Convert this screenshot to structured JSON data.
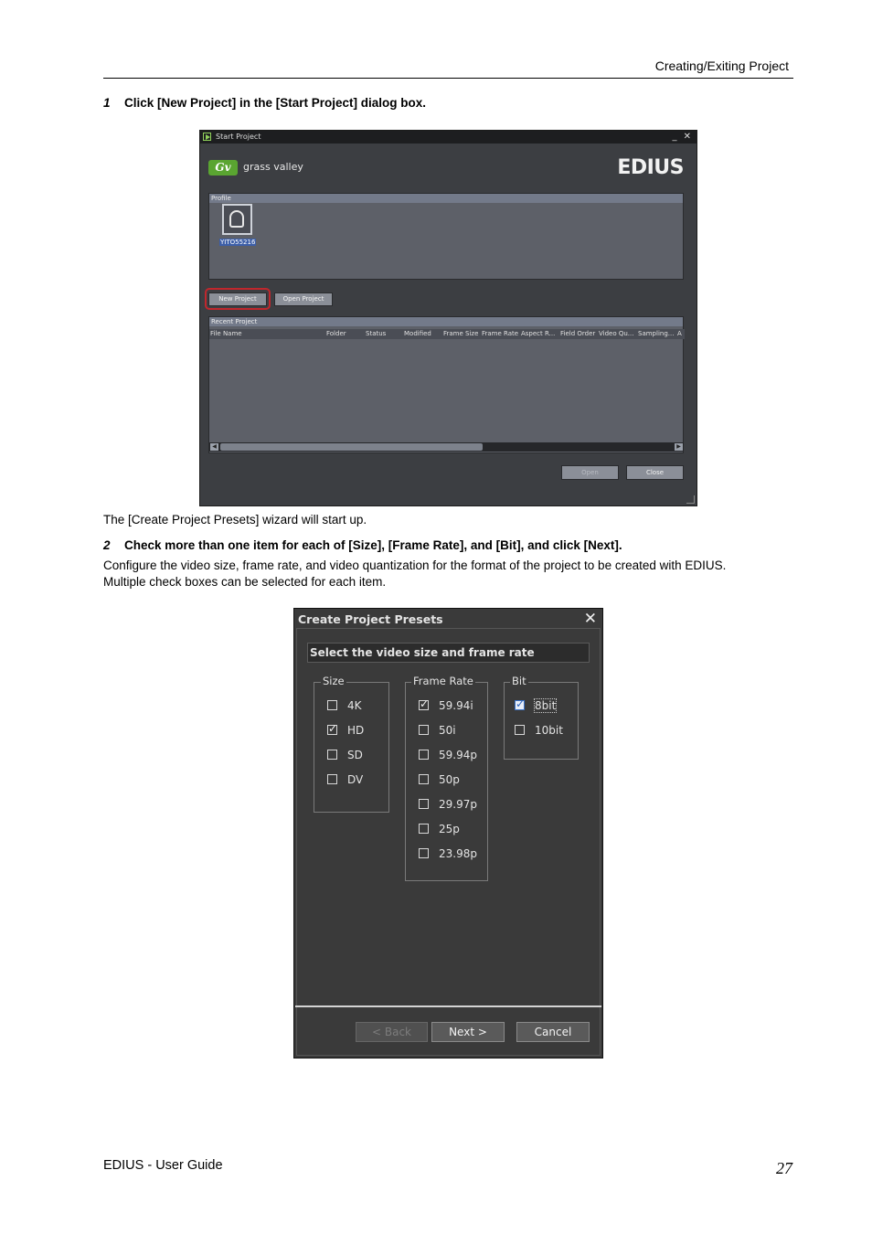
{
  "header": {
    "title": "Creating/Exiting Project"
  },
  "step1": {
    "num": "1",
    "text": "Click [New Project] in the [Start Project] dialog box."
  },
  "start_project": {
    "title": "Start Project",
    "win_controls": "_ ✕",
    "brand_mark": "Gv",
    "brand": "grass valley",
    "product": "EDIUS",
    "profile_header": "Profile",
    "profile_name": "YITO55216",
    "new_project": "New Project",
    "open_project": "Open Project",
    "recent_header": "Recent Project",
    "columns": [
      "File Name",
      "Folder",
      "Status",
      "Modified",
      "Frame Size",
      "Frame Rate",
      "Aspect R...",
      "Field Order",
      "Video Qu...",
      "Sampling...",
      "A"
    ],
    "open_btn": "Open",
    "close_btn": "Close"
  },
  "after1": "The [Create Project Presets] wizard will start up.",
  "step2": {
    "num": "2",
    "text": "Check more than one item for each of [Size], [Frame Rate], and [Bit], and click [Next].",
    "desc1": "Configure the video size, frame rate, and video quantization for the format of the project to be created with EDIUS.",
    "desc2": "Multiple check boxes can be selected for each item."
  },
  "create_presets": {
    "title": "Create Project Presets",
    "close": "✕",
    "instruction": "Select the video size and frame rate",
    "size_label": "Size",
    "sizes": [
      {
        "label": "4K",
        "checked": false
      },
      {
        "label": "HD",
        "checked": true
      },
      {
        "label": "SD",
        "checked": false
      },
      {
        "label": "DV",
        "checked": false
      }
    ],
    "frame_rate_label": "Frame Rate",
    "frame_rates": [
      {
        "label": "59.94i",
        "checked": true
      },
      {
        "label": "50i",
        "checked": false
      },
      {
        "label": "59.94p",
        "checked": false
      },
      {
        "label": "50p",
        "checked": false
      },
      {
        "label": "29.97p",
        "checked": false
      },
      {
        "label": "25p",
        "checked": false
      },
      {
        "label": "23.98p",
        "checked": false
      }
    ],
    "bit_label": "Bit",
    "bits": [
      {
        "label": "8bit",
        "checked": true
      },
      {
        "label": "10bit",
        "checked": false
      }
    ],
    "back": "< Back",
    "next": "Next >",
    "cancel": "Cancel"
  },
  "footer": {
    "left": "EDIUS - User Guide",
    "page": "27"
  }
}
